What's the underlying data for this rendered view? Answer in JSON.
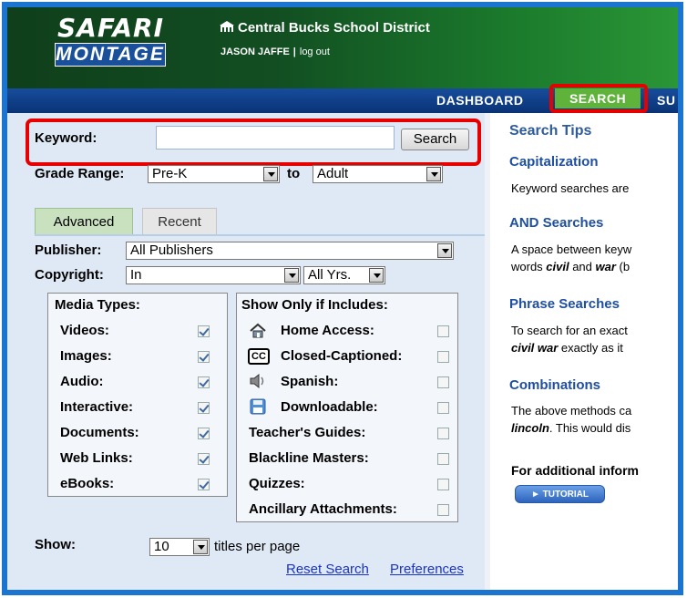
{
  "header": {
    "logo_top": "SAFARI",
    "logo_bottom": "MONTAGE",
    "school_name": "Central Bucks School District",
    "user_name": "JASON JAFFE",
    "separator": "|",
    "logout_label": "log out"
  },
  "nav": {
    "dashboard": "DASHBOARD",
    "search": "SEARCH",
    "more": "SU"
  },
  "search": {
    "keyword_label": "Keyword:",
    "keyword_value": "",
    "search_button": "Search",
    "grade_label": "Grade Range:",
    "grade_from": "Pre-K",
    "grade_to_label": "to",
    "grade_to": "Adult"
  },
  "tabs": {
    "advanced": "Advanced",
    "recent": "Recent"
  },
  "filters": {
    "publisher_label": "Publisher:",
    "publisher_value": "All Publishers",
    "copyright_label": "Copyright:",
    "copyright_mode": "In",
    "copyright_years": "All Yrs."
  },
  "media_types": {
    "title": "Media Types:",
    "items": [
      {
        "label": "Videos:",
        "checked": true
      },
      {
        "label": "Images:",
        "checked": true
      },
      {
        "label": "Audio:",
        "checked": true
      },
      {
        "label": "Interactive:",
        "checked": true
      },
      {
        "label": "Documents:",
        "checked": true
      },
      {
        "label": "Web Links:",
        "checked": true
      },
      {
        "label": "eBooks:",
        "checked": true
      }
    ]
  },
  "includes": {
    "title": "Show Only if Includes:",
    "items": [
      {
        "label": "Home Access:",
        "icon": "home-icon",
        "checked": false
      },
      {
        "label": "Closed-Captioned:",
        "icon": "cc-icon",
        "checked": false
      },
      {
        "label": "Spanish:",
        "icon": "speaker-icon",
        "checked": false
      },
      {
        "label": "Downloadable:",
        "icon": "floppy-disk-icon",
        "checked": false
      },
      {
        "label": "Teacher's Guides:",
        "checked": false
      },
      {
        "label": "Blackline Masters:",
        "checked": false
      },
      {
        "label": "Quizzes:",
        "checked": false
      },
      {
        "label": "Ancillary Attachments:",
        "checked": false
      }
    ],
    "cc_text": "CC"
  },
  "footer": {
    "show_label": "Show:",
    "per_page": "10",
    "per_page_suffix": "titles per page",
    "reset_link": "Reset Search",
    "preferences_link": "Preferences"
  },
  "tips": {
    "title": "Search Tips",
    "cap_heading": "Capitalization",
    "cap_text": "Keyword searches are",
    "and_heading": "AND Searches",
    "and_line1": "A space between keyw",
    "and_line2_pre": "words ",
    "and_line2_b1": "civil",
    "and_line2_mid": " and ",
    "and_line2_b2": "war",
    "and_line2_post": " (b",
    "phrase_heading": "Phrase Searches",
    "phrase_line1": "To search for an exact",
    "phrase_line2_b": "civil war",
    "phrase_line2_post": " exactly as it",
    "comb_heading": "Combinations",
    "comb_line1": "The above methods ca",
    "comb_line2_b": "lincoln",
    "comb_line2_post": ". This would dis",
    "additional": "For additional inform",
    "tutorial_button": "► TUTORIAL"
  },
  "colors": {
    "highlight_red": "#e60000",
    "frame_blue": "#1b75d0",
    "search_tab_green": "#5fb23a",
    "link_blue": "#1a33c8"
  }
}
